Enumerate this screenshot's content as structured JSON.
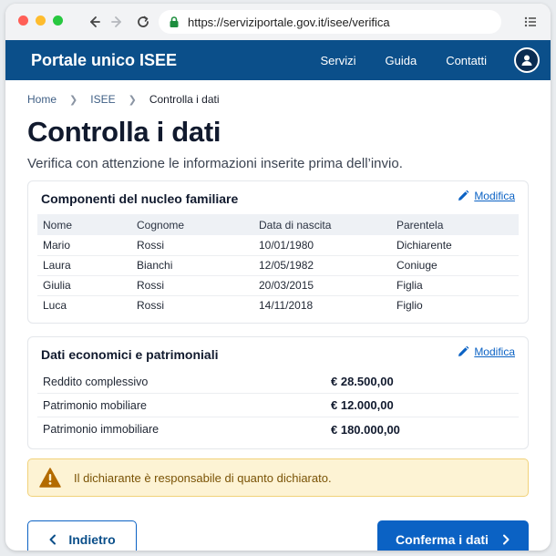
{
  "browser": {
    "url": "https://serviziportale.gov.it/isee/verifica"
  },
  "header": {
    "brand": "Portale unico ISEE",
    "nav": [
      "Servizi",
      "Guida",
      "Contatti"
    ]
  },
  "breadcrumb": {
    "items": [
      "Home",
      "ISEE"
    ],
    "current": "Controlla i dati"
  },
  "page": {
    "title": "Controlla i dati",
    "subtitle": "Verifica con attenzione le informazioni inserite prima dell’invio."
  },
  "household": {
    "title": "Componenti del nucleo familiare",
    "edit_label": "Modifica",
    "columns": [
      "Nome",
      "Cognome",
      "Data di nascita",
      "Parentela"
    ],
    "rows": [
      [
        "Mario",
        "Rossi",
        "10/01/1980",
        "Dichiarente"
      ],
      [
        "Laura",
        "Bianchi",
        "12/05/1982",
        "Coniuge"
      ],
      [
        "Giulia",
        "Rossi",
        "20/03/2015",
        "Figlia"
      ],
      [
        "Luca",
        "Rossi",
        "14/11/2018",
        "Figlio"
      ]
    ]
  },
  "economic": {
    "title": "Dati economici e patrimoniali",
    "edit_label": "Modifica",
    "rows": [
      {
        "label": "Reddito complessivo",
        "value": "€ 28.500,00"
      },
      {
        "label": "Patrimonio mobiliare",
        "value": "€ 12.000,00"
      },
      {
        "label": "Patrimonio immobiliare",
        "value": "€ 180.000,00"
      }
    ]
  },
  "alert": {
    "text": "Il dichiarante è responsabile di quanto dichiarato."
  },
  "actions": {
    "back_label": "Indietro",
    "confirm_label": "Conferma i dati"
  },
  "colors": {
    "header_bg": "#0b4f8a",
    "primary": "#0b62c4",
    "alert_bg": "#fdf3d4",
    "alert_icon": "#b36b00"
  },
  "icons": {
    "lock": "lock-icon",
    "edit": "pencil-icon",
    "warning": "warning-icon",
    "user": "user-icon"
  }
}
